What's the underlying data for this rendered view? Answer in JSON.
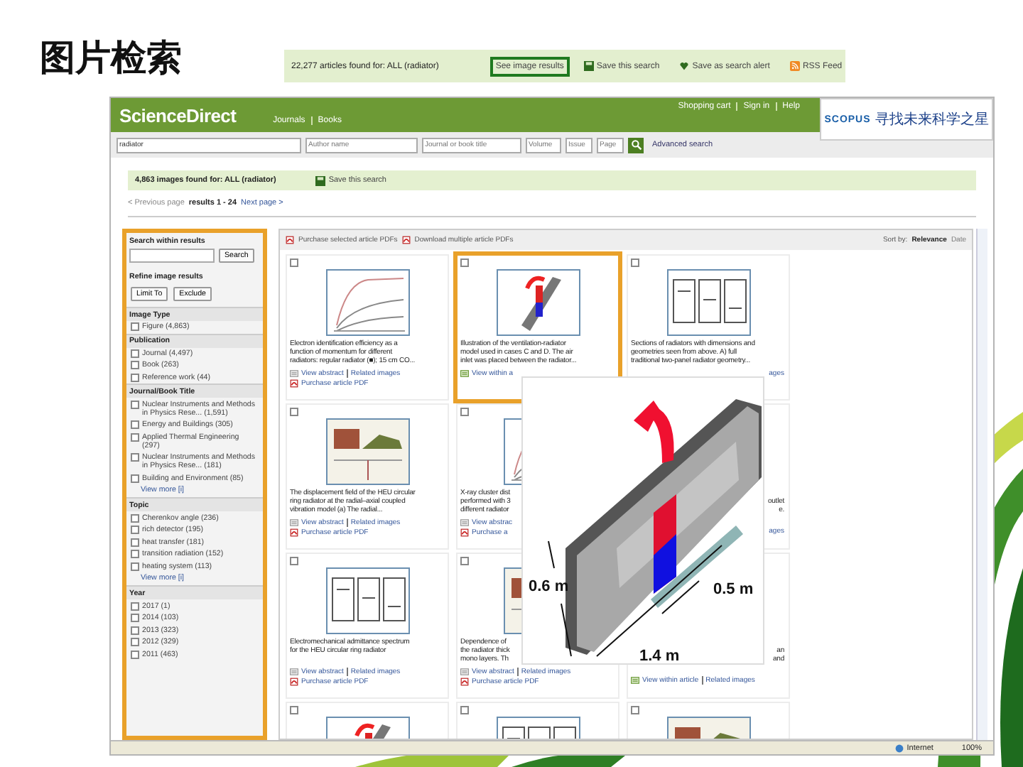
{
  "slide": {
    "title": "图片检索"
  },
  "summary_strip": {
    "count": "22,277 articles found for: ALL (radiator)",
    "links": [
      {
        "label": "See image results",
        "highlighted": true
      },
      {
        "label": "Save this search",
        "highlighted": false
      },
      {
        "label": "Save as search alert",
        "highlighted": false
      },
      {
        "label": "RSS Feed",
        "highlighted": false
      }
    ]
  },
  "header": {
    "logo": "ScienceDirect",
    "nav": [
      "Journals",
      "Books"
    ],
    "account": [
      "Shopping cart",
      "Sign in",
      "Help"
    ],
    "badge": {
      "name": "SCOPUS",
      "tagline": "寻找未来科学之星"
    }
  },
  "search": {
    "fields": [
      {
        "value": "radiator"
      },
      {
        "placeholder": "Author name"
      },
      {
        "placeholder": "Journal or book title"
      },
      {
        "placeholder": "Volume"
      },
      {
        "placeholder": "Issue"
      },
      {
        "placeholder": "Page"
      }
    ],
    "advanced": "Advanced search"
  },
  "results_bar": {
    "count": "4,863 images found for: ALL (radiator)",
    "save": "Save this search"
  },
  "pager": {
    "previous": "< Previous page",
    "range": "results 1 - 24",
    "next": "Next page >"
  },
  "sidebar": {
    "highlighted": true,
    "search_title": "Search within results",
    "search_button": "Search",
    "refine_title": "Refine image results",
    "buttons": [
      "Limit To",
      "Exclude"
    ],
    "groups": [
      {
        "title": "Image Type",
        "items": [
          {
            "label": "Figure (4,863)",
            "checked": false
          }
        ]
      },
      {
        "title": "Publication",
        "items": [
          {
            "label": "Journal (4,497)",
            "checked": false
          },
          {
            "label": "Book (263)",
            "checked": false
          },
          {
            "label": "Reference work (44)",
            "checked": false
          }
        ]
      },
      {
        "title": "Journal/Book Title",
        "items": [
          {
            "label": "Nuclear Instruments and Methods in Physics Rese... (1,591)",
            "checked": false
          },
          {
            "label": "Energy and Buildings (305)",
            "checked": false
          },
          {
            "label": "Applied Thermal Engineering (297)",
            "checked": false
          },
          {
            "label": "Nuclear Instruments and Methods in Physics Rese... (181)",
            "checked": false
          },
          {
            "label": "Building and Environment (85)",
            "checked": false
          }
        ],
        "more": "View more [i]"
      },
      {
        "title": "Topic",
        "items": [
          {
            "label": "Cherenkov angle (236)",
            "checked": false
          },
          {
            "label": "rich detector (195)",
            "checked": false
          },
          {
            "label": "heat transfer (181)",
            "checked": false
          },
          {
            "label": "transition radiation (152)",
            "checked": false
          },
          {
            "label": "heating system (113)",
            "checked": false
          }
        ],
        "more": "View more [i]"
      },
      {
        "title": "Year",
        "items": [
          {
            "label": "2017 (1)",
            "checked": false
          },
          {
            "label": "2014 (103)",
            "checked": false
          },
          {
            "label": "2013 (323)",
            "checked": false
          },
          {
            "label": "2012 (329)",
            "checked": false
          },
          {
            "label": "2011 (463)",
            "checked": false
          }
        ]
      }
    ]
  },
  "toolbar": {
    "links": [
      "Purchase selected article PDFs",
      "Download multiple article PDFs"
    ],
    "sort_label": "Sort by:",
    "sort_options": [
      {
        "label": "Relevance",
        "selected": true
      },
      {
        "label": "Date",
        "selected": false
      }
    ]
  },
  "cards": [
    {
      "kind": "full",
      "checked": false,
      "thumbnail": true,
      "highlighted": false,
      "caption": [
        "Electron identification efficiency as a",
        "function of momentum for different",
        "radiators: regular radiator (■); 15 cm CO..."
      ],
      "actions": [
        {
          "kind": "abstract",
          "label": "View abstract"
        },
        {
          "kind": "link",
          "label": "Related images"
        }
      ],
      "purchase": "Purchase article PDF"
    },
    {
      "kind": "full",
      "checked": false,
      "thumbnail": true,
      "highlighted": true,
      "caption": [
        "Illustration of the ventilation-radiator",
        "model used in cases C and D. The air",
        "inlet was placed between the radiator..."
      ],
      "actions": [
        {
          "kind": "article",
          "label": "View within a"
        }
      ]
    },
    {
      "kind": "full",
      "checked": false,
      "thumbnail": true,
      "highlighted": false,
      "caption": [
        "Sections of radiators with dimensions and",
        "geometries seen from above. A) full",
        "traditional two-panel radiator geometry..."
      ],
      "actions": [
        {
          "kind": "fragment",
          "label": "ages"
        }
      ]
    },
    {
      "kind": "full",
      "checked": false,
      "thumbnail": true,
      "highlighted": false,
      "caption": [
        "The displacement field of the HEU circular",
        "ring radiator at the radial–axial coupled",
        "vibration model (a) The radial..."
      ],
      "actions": [
        {
          "kind": "abstract",
          "label": "View abstract"
        },
        {
          "kind": "link",
          "label": "Related images"
        }
      ],
      "purchase": "Purchase article PDF"
    },
    {
      "kind": "covered",
      "checked": false,
      "thumbnail": true,
      "highlighted": false,
      "caption": [
        "X-ray cluster dist",
        "performed with 3",
        "different radiator"
      ],
      "actions": [
        {
          "kind": "abstract",
          "label": "View abstrac"
        }
      ],
      "purchase": "Purchase a"
    },
    {
      "kind": "clipped",
      "thumbnail": false,
      "highlighted": false,
      "caption": [
        "outlet",
        "e."
      ],
      "actions": [
        {
          "kind": "fragment",
          "label": "ages"
        }
      ]
    },
    {
      "kind": "full",
      "checked": false,
      "thumbnail": true,
      "highlighted": false,
      "caption": [
        "Electromechanical admittance spectrum",
        "for the HEU circular ring radiator"
      ],
      "actions": [
        {
          "kind": "abstract",
          "label": "View abstract"
        },
        {
          "kind": "link",
          "label": "Related images"
        }
      ],
      "purchase": "Purchase article PDF"
    },
    {
      "kind": "covered",
      "checked": false,
      "thumbnail": true,
      "highlighted": false,
      "caption": [
        "Dependence of",
        "the radiator thick",
        "mono layers. Th"
      ],
      "actions": [
        {
          "kind": "abstract",
          "label": "View abstract"
        },
        {
          "kind": "link",
          "label": "Related images"
        }
      ],
      "purchase": "Purchase article PDF"
    },
    {
      "kind": "clipped",
      "thumbnail": false,
      "highlighted": false,
      "caption": [
        "an",
        "and"
      ],
      "actions": [
        {
          "kind": "article",
          "label": "View within article"
        },
        {
          "kind": "link",
          "label": "Related images"
        }
      ]
    },
    {
      "kind": "full",
      "checked": false,
      "thumbnail": true,
      "highlighted": false
    },
    {
      "kind": "full",
      "checked": false,
      "thumbnail": true,
      "highlighted": false
    },
    {
      "kind": "full",
      "checked": false,
      "thumbnail": true,
      "highlighted": false
    }
  ],
  "zoomed_figure": {
    "labels": [
      "0.6 m",
      "0.5 m",
      "1.4 m"
    ]
  },
  "status_bar": {
    "zone": "Internet",
    "zoom": "100%"
  }
}
